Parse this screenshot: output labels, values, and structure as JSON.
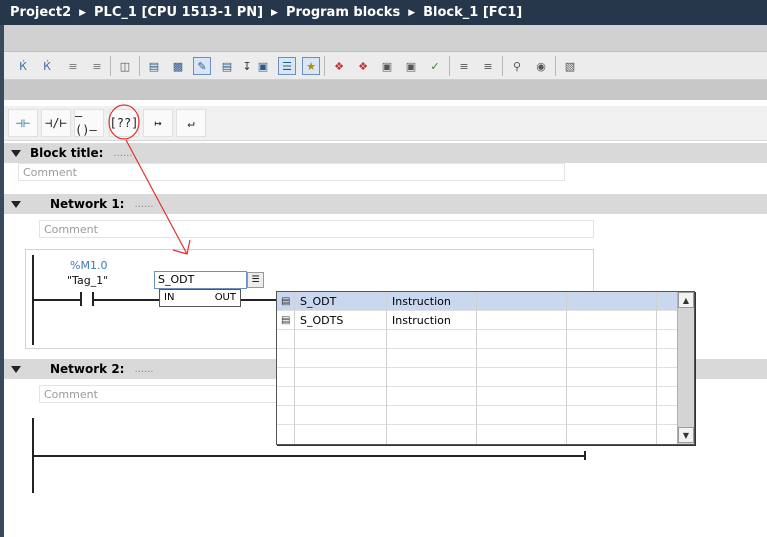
{
  "breadcrumb": [
    "Project2",
    "PLC_1 [CPU 1513-1 PN]",
    "Program blocks",
    "Block_1 [FC1]"
  ],
  "toolbar_icons": [
    "insert-network-icon",
    "delete-network-icon",
    "insert-row-icon",
    "add-row-icon",
    "compare-icon",
    "block-interface-icon",
    "absolute-operands-icon",
    "comment-icon",
    "favorites-icon",
    "network-comments-icon",
    "open-all-networks-icon",
    "close-all-networks-icon",
    "go-to-error-icon",
    "next-error-icon",
    "previous-error-icon",
    "monitor-icon",
    "toggle-monitoring-icon",
    "indent-icon",
    "outdent-icon",
    "find-icon",
    "view-icon",
    "snapshot-icon"
  ],
  "ladder_palette": [
    "no-contact",
    "nc-contact",
    "coil",
    "empty-box",
    "open-branch",
    "close-branch"
  ],
  "block_title": {
    "label": "Block title:",
    "dots": "......",
    "comment": "Comment"
  },
  "network1": {
    "label": "Network 1:",
    "dots": "......",
    "comment": "Comment",
    "address": "%M1.0",
    "tag": "\"Tag_1\"",
    "instruction_input": "S_ODT",
    "in_label": "IN",
    "out_label": "OUT"
  },
  "network2": {
    "label": "Network 2:",
    "dots": "......",
    "comment": "Comment"
  },
  "dropdown": {
    "rows": [
      {
        "name": "S_ODT",
        "type": "Instruction",
        "selected": true
      },
      {
        "name": "S_ODTS",
        "type": "Instruction",
        "selected": false
      }
    ]
  },
  "colors": {
    "header_bg": "#27374b",
    "address": "#3a7ab5",
    "selection": "#c9d8ee",
    "annotation": "#e03030"
  }
}
